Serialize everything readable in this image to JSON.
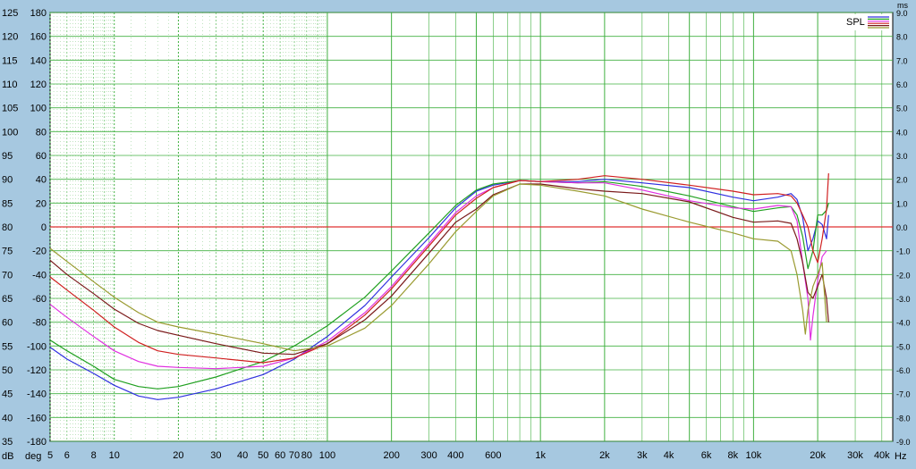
{
  "chart_data": {
    "type": "line",
    "x_scale": "log",
    "xlim": [
      5,
      45000
    ],
    "x_ticks": [
      5,
      6,
      8,
      10,
      20,
      30,
      40,
      50,
      60,
      70,
      80,
      100,
      200,
      300,
      400,
      600,
      1000,
      2000,
      3000,
      4000,
      6000,
      8000,
      10000,
      20000,
      30000,
      40000
    ],
    "x_tick_labels": [
      "5",
      "6",
      "8",
      "10",
      "20",
      "30",
      "40",
      "50",
      "60",
      "70",
      "80",
      "100",
      "200",
      "300",
      "400",
      "600",
      "1k",
      "2k",
      "3k",
      "4k",
      "6k",
      "8k",
      "10k",
      "20k",
      "30k",
      "40k"
    ],
    "x_unit": "Hz",
    "y_db_ticks": [
      35,
      40,
      45,
      50,
      55,
      60,
      65,
      70,
      75,
      80,
      85,
      90,
      95,
      100,
      105,
      110,
      115,
      120,
      125
    ],
    "y_db_unit": "dB",
    "y_deg_ticks": [
      "180",
      "160",
      "140",
      "120",
      "100",
      "80",
      "60",
      "40",
      "20",
      "0",
      "-20",
      "-40",
      "-60",
      "-80",
      "-100",
      "-120",
      "-140",
      "-160",
      "-180"
    ],
    "y_deg_unit": "deg",
    "y_ms_ticks": [
      "9.0",
      "8.0",
      "7.0",
      "6.0",
      "5.0",
      "4.0",
      "3.0",
      "2.0",
      "1.0",
      "0.0",
      "-1.0",
      "-2.0",
      "-3.0",
      "-4.0",
      "-5.0",
      "-6.0",
      "-7.0",
      "-8.0",
      "-9.0"
    ],
    "y_ms_unit": "ms",
    "ylim_deg": [
      -180,
      180
    ],
    "reference_line_deg": 0,
    "grid": true,
    "legend": {
      "label": "SPL",
      "placement": "top-right"
    },
    "series": [
      {
        "color": "#3030e0",
        "points": [
          [
            5,
            -101
          ],
          [
            6,
            -111
          ],
          [
            8,
            -123
          ],
          [
            10,
            -133
          ],
          [
            13,
            -142
          ],
          [
            16,
            -145
          ],
          [
            20,
            -143
          ],
          [
            30,
            -136
          ],
          [
            50,
            -124
          ],
          [
            70,
            -111
          ],
          [
            100,
            -92
          ],
          [
            150,
            -66
          ],
          [
            200,
            -42
          ],
          [
            300,
            -9
          ],
          [
            400,
            16
          ],
          [
            500,
            30
          ],
          [
            600,
            35
          ],
          [
            800,
            39
          ],
          [
            1000,
            38
          ],
          [
            1500,
            38
          ],
          [
            2000,
            40
          ],
          [
            3000,
            37
          ],
          [
            5000,
            33
          ],
          [
            8000,
            25
          ],
          [
            10000,
            22
          ],
          [
            13000,
            25
          ],
          [
            15000,
            28
          ],
          [
            16000,
            23
          ],
          [
            17000,
            8
          ],
          [
            18000,
            -20
          ],
          [
            19000,
            -10
          ],
          [
            20000,
            5
          ],
          [
            21000,
            2
          ],
          [
            22000,
            -10
          ],
          [
            22500,
            10
          ]
        ]
      },
      {
        "color": "#20a020",
        "points": [
          [
            5,
            -95
          ],
          [
            6,
            -104
          ],
          [
            8,
            -117
          ],
          [
            10,
            -128
          ],
          [
            13,
            -134
          ],
          [
            16,
            -136
          ],
          [
            20,
            -134
          ],
          [
            30,
            -126
          ],
          [
            50,
            -113
          ],
          [
            70,
            -100
          ],
          [
            100,
            -83
          ],
          [
            150,
            -59
          ],
          [
            200,
            -37
          ],
          [
            300,
            -5
          ],
          [
            400,
            18
          ],
          [
            500,
            31
          ],
          [
            600,
            36
          ],
          [
            800,
            39
          ],
          [
            1000,
            38
          ],
          [
            1500,
            37
          ],
          [
            2000,
            38
          ],
          [
            3000,
            34
          ],
          [
            5000,
            26
          ],
          [
            8000,
            17
          ],
          [
            10000,
            13
          ],
          [
            13000,
            16
          ],
          [
            15000,
            17
          ],
          [
            16000,
            10
          ],
          [
            17000,
            -8
          ],
          [
            18000,
            -35
          ],
          [
            19000,
            -20
          ],
          [
            20000,
            10
          ],
          [
            21000,
            10
          ],
          [
            22000,
            14
          ],
          [
            22500,
            20
          ]
        ]
      },
      {
        "color": "#e030e0",
        "points": [
          [
            5,
            -65
          ],
          [
            6,
            -76
          ],
          [
            8,
            -92
          ],
          [
            10,
            -104
          ],
          [
            13,
            -113
          ],
          [
            16,
            -117
          ],
          [
            20,
            -118
          ],
          [
            30,
            -119
          ],
          [
            50,
            -117
          ],
          [
            70,
            -110
          ],
          [
            100,
            -96
          ],
          [
            150,
            -72
          ],
          [
            200,
            -50
          ],
          [
            300,
            -14
          ],
          [
            400,
            12
          ],
          [
            500,
            26
          ],
          [
            600,
            33
          ],
          [
            800,
            39
          ],
          [
            1000,
            38
          ],
          [
            1500,
            37
          ],
          [
            2000,
            37
          ],
          [
            3000,
            31
          ],
          [
            5000,
            22
          ],
          [
            8000,
            16
          ],
          [
            10000,
            15
          ],
          [
            13000,
            18
          ],
          [
            15000,
            17
          ],
          [
            16000,
            5
          ],
          [
            17000,
            -30
          ],
          [
            18000,
            -60
          ],
          [
            18500,
            -95
          ],
          [
            19000,
            -75
          ],
          [
            20000,
            -45
          ],
          [
            21000,
            -25
          ],
          [
            22000,
            -20
          ]
        ]
      },
      {
        "color": "#d02020",
        "points": [
          [
            5,
            -42
          ],
          [
            6,
            -53
          ],
          [
            8,
            -70
          ],
          [
            10,
            -84
          ],
          [
            13,
            -97
          ],
          [
            16,
            -104
          ],
          [
            20,
            -107
          ],
          [
            30,
            -110
          ],
          [
            50,
            -114
          ],
          [
            70,
            -110
          ],
          [
            100,
            -98
          ],
          [
            150,
            -74
          ],
          [
            200,
            -52
          ],
          [
            300,
            -16
          ],
          [
            400,
            10
          ],
          [
            500,
            24
          ],
          [
            600,
            33
          ],
          [
            800,
            39
          ],
          [
            1000,
            38
          ],
          [
            1500,
            40
          ],
          [
            2000,
            43
          ],
          [
            3000,
            40
          ],
          [
            5000,
            35
          ],
          [
            8000,
            30
          ],
          [
            10000,
            27
          ],
          [
            13000,
            28
          ],
          [
            15000,
            26
          ],
          [
            16000,
            20
          ],
          [
            17000,
            10
          ],
          [
            18000,
            0
          ],
          [
            19000,
            -20
          ],
          [
            20000,
            -30
          ],
          [
            21000,
            -10
          ],
          [
            22000,
            15
          ],
          [
            22500,
            45
          ]
        ]
      },
      {
        "color": "#7a1a1a",
        "points": [
          [
            5,
            -28
          ],
          [
            6,
            -40
          ],
          [
            8,
            -56
          ],
          [
            10,
            -69
          ],
          [
            13,
            -81
          ],
          [
            16,
            -87
          ],
          [
            20,
            -91
          ],
          [
            30,
            -98
          ],
          [
            50,
            -106
          ],
          [
            70,
            -107
          ],
          [
            100,
            -98
          ],
          [
            150,
            -78
          ],
          [
            200,
            -58
          ],
          [
            300,
            -22
          ],
          [
            400,
            4
          ],
          [
            500,
            15
          ],
          [
            600,
            27
          ],
          [
            800,
            36
          ],
          [
            1000,
            36
          ],
          [
            1500,
            32
          ],
          [
            2000,
            30
          ],
          [
            3000,
            28
          ],
          [
            5000,
            21
          ],
          [
            8000,
            8
          ],
          [
            10000,
            4
          ],
          [
            13000,
            5
          ],
          [
            15000,
            3
          ],
          [
            16000,
            -10
          ],
          [
            17000,
            -30
          ],
          [
            18000,
            -55
          ],
          [
            19000,
            -60
          ],
          [
            20000,
            -50
          ],
          [
            21000,
            -40
          ],
          [
            22000,
            -60
          ],
          [
            22500,
            -80
          ]
        ]
      },
      {
        "color": "#9a9a30",
        "points": [
          [
            5,
            -18
          ],
          [
            6,
            -29
          ],
          [
            8,
            -46
          ],
          [
            10,
            -59
          ],
          [
            13,
            -72
          ],
          [
            16,
            -80
          ],
          [
            20,
            -84
          ],
          [
            30,
            -90
          ],
          [
            50,
            -98
          ],
          [
            70,
            -104
          ],
          [
            100,
            -100
          ],
          [
            150,
            -85
          ],
          [
            200,
            -66
          ],
          [
            300,
            -31
          ],
          [
            400,
            -4
          ],
          [
            500,
            13
          ],
          [
            600,
            26
          ],
          [
            800,
            36
          ],
          [
            1000,
            35
          ],
          [
            1500,
            30
          ],
          [
            2000,
            26
          ],
          [
            3000,
            15
          ],
          [
            5000,
            4
          ],
          [
            8000,
            -5
          ],
          [
            10000,
            -10
          ],
          [
            13000,
            -12
          ],
          [
            15000,
            -20
          ],
          [
            16000,
            -40
          ],
          [
            17000,
            -70
          ],
          [
            17500,
            -90
          ],
          [
            18000,
            -70
          ],
          [
            19000,
            -50
          ],
          [
            20000,
            -40
          ],
          [
            21000,
            -30
          ],
          [
            22000,
            -80
          ]
        ]
      }
    ]
  }
}
